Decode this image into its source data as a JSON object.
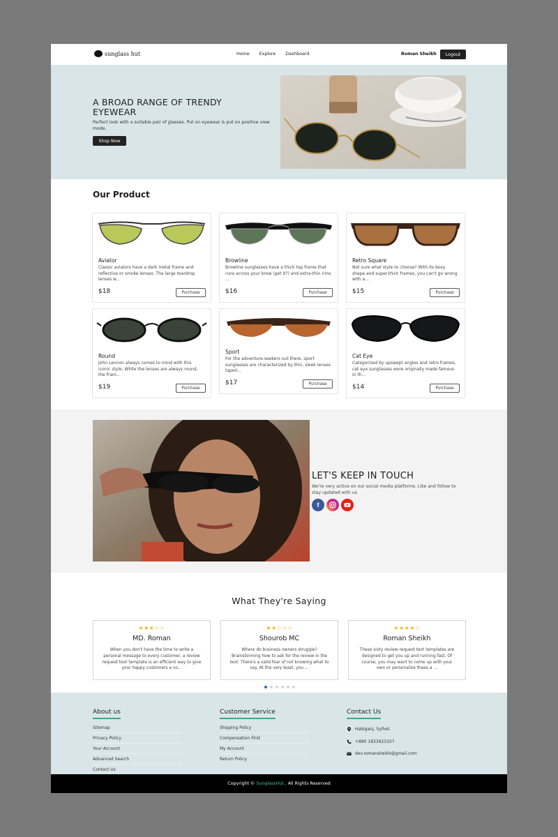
{
  "nav": {
    "logo_text": "sunglass hut",
    "links": [
      "Home",
      "Explore",
      "Dashboard"
    ],
    "user_name": "Roman Sheikh",
    "logout_label": "Logout"
  },
  "hero": {
    "title": "A BROAD RANGE OF TRENDY EYEWEAR",
    "subtitle": "Perfect look with a suitable pair of glasses. Put on eyewear & put on positive view mode.",
    "button_label": "Shop Now"
  },
  "products": {
    "title": "Our Product",
    "button_label": "Purchase",
    "items": [
      {
        "name": "Aviator",
        "desc": "Classic aviators have a dark metal frame and reflective or smoke lenses. The large teardrop lenses w...",
        "price": "$18"
      },
      {
        "name": "Browline",
        "desc": "Browline sunglasses have a thick top frame that runs across your brow (get it?) and extra-thin rims ...",
        "price": "$16"
      },
      {
        "name": "Retro Square",
        "desc": "Not sure what style to choose? With its boxy shape and super-thick frames, you can't go wrong with a...",
        "price": "$15"
      },
      {
        "name": "Round",
        "desc": "John Lennon always comes to mind with this iconic style. While the lenses are always round, the fram...",
        "price": "$19"
      },
      {
        "name": "Sport",
        "desc": "For the adventure-seekers out there, sport sunglasses are characterized by thin, sleek lenses taperi...",
        "price": "$17"
      },
      {
        "name": "Cat Eye",
        "desc": "Categorized by upswept angles and retro frames, cat eye sunglasses were originally made famous in th...",
        "price": "$14"
      }
    ]
  },
  "contact": {
    "title": "LET'S KEEP IN TOUCH",
    "subtitle": "We're very active on our social media platforms. Like and follow to stay updated with us",
    "socials": [
      "facebook-icon",
      "instagram-icon",
      "youtube-icon"
    ]
  },
  "reviews": {
    "title": "What They're Saying",
    "items": [
      {
        "stars": "★★★☆☆",
        "name": "MD. Roman",
        "text": "When you don't have the time to write a personal message to every customer, a review request text template is an efficient way to give your happy customers a vo..."
      },
      {
        "stars": "★★☆☆☆",
        "name": "Shourob MC",
        "text": "Where do business owners struggle? Brainstorming how to ask for the review in the text. There's a valid fear of not knowing what to say. At the very least, you ..."
      },
      {
        "stars": "★★★★☆",
        "name": "Roman Sheikh",
        "text": "These sixty review request text templates are designed to get you up and running fast. Of course, you may want to come up with your own or personalize these a ..."
      }
    ],
    "carousel_dots": 6,
    "active_dot": 1
  },
  "footer": {
    "about": {
      "heading": "About us",
      "links": [
        "Sitemap",
        "Privacy Policy",
        "Your Account",
        "Advanced Search",
        "Contact Us"
      ]
    },
    "service": {
      "heading": "Customer Service",
      "links": [
        "Shipping Policy",
        "Compensation First",
        "My Account",
        "Return Policy"
      ]
    },
    "contact": {
      "heading": "Contact Us",
      "address": "Habiganj, Sylhet.",
      "phone": "+880 1833923107",
      "email": "dev.romansheikh@gmail.com"
    },
    "copyright_prefix": "Copyright ©",
    "copyright_brand": "SunglassHut",
    "copyright_suffix": ". All Rights Reserved"
  },
  "colors": {
    "hero_bg": "#d9e6e8",
    "accent": "#3aa88f",
    "star": "#f2b01e",
    "dark_button": "#222222"
  }
}
